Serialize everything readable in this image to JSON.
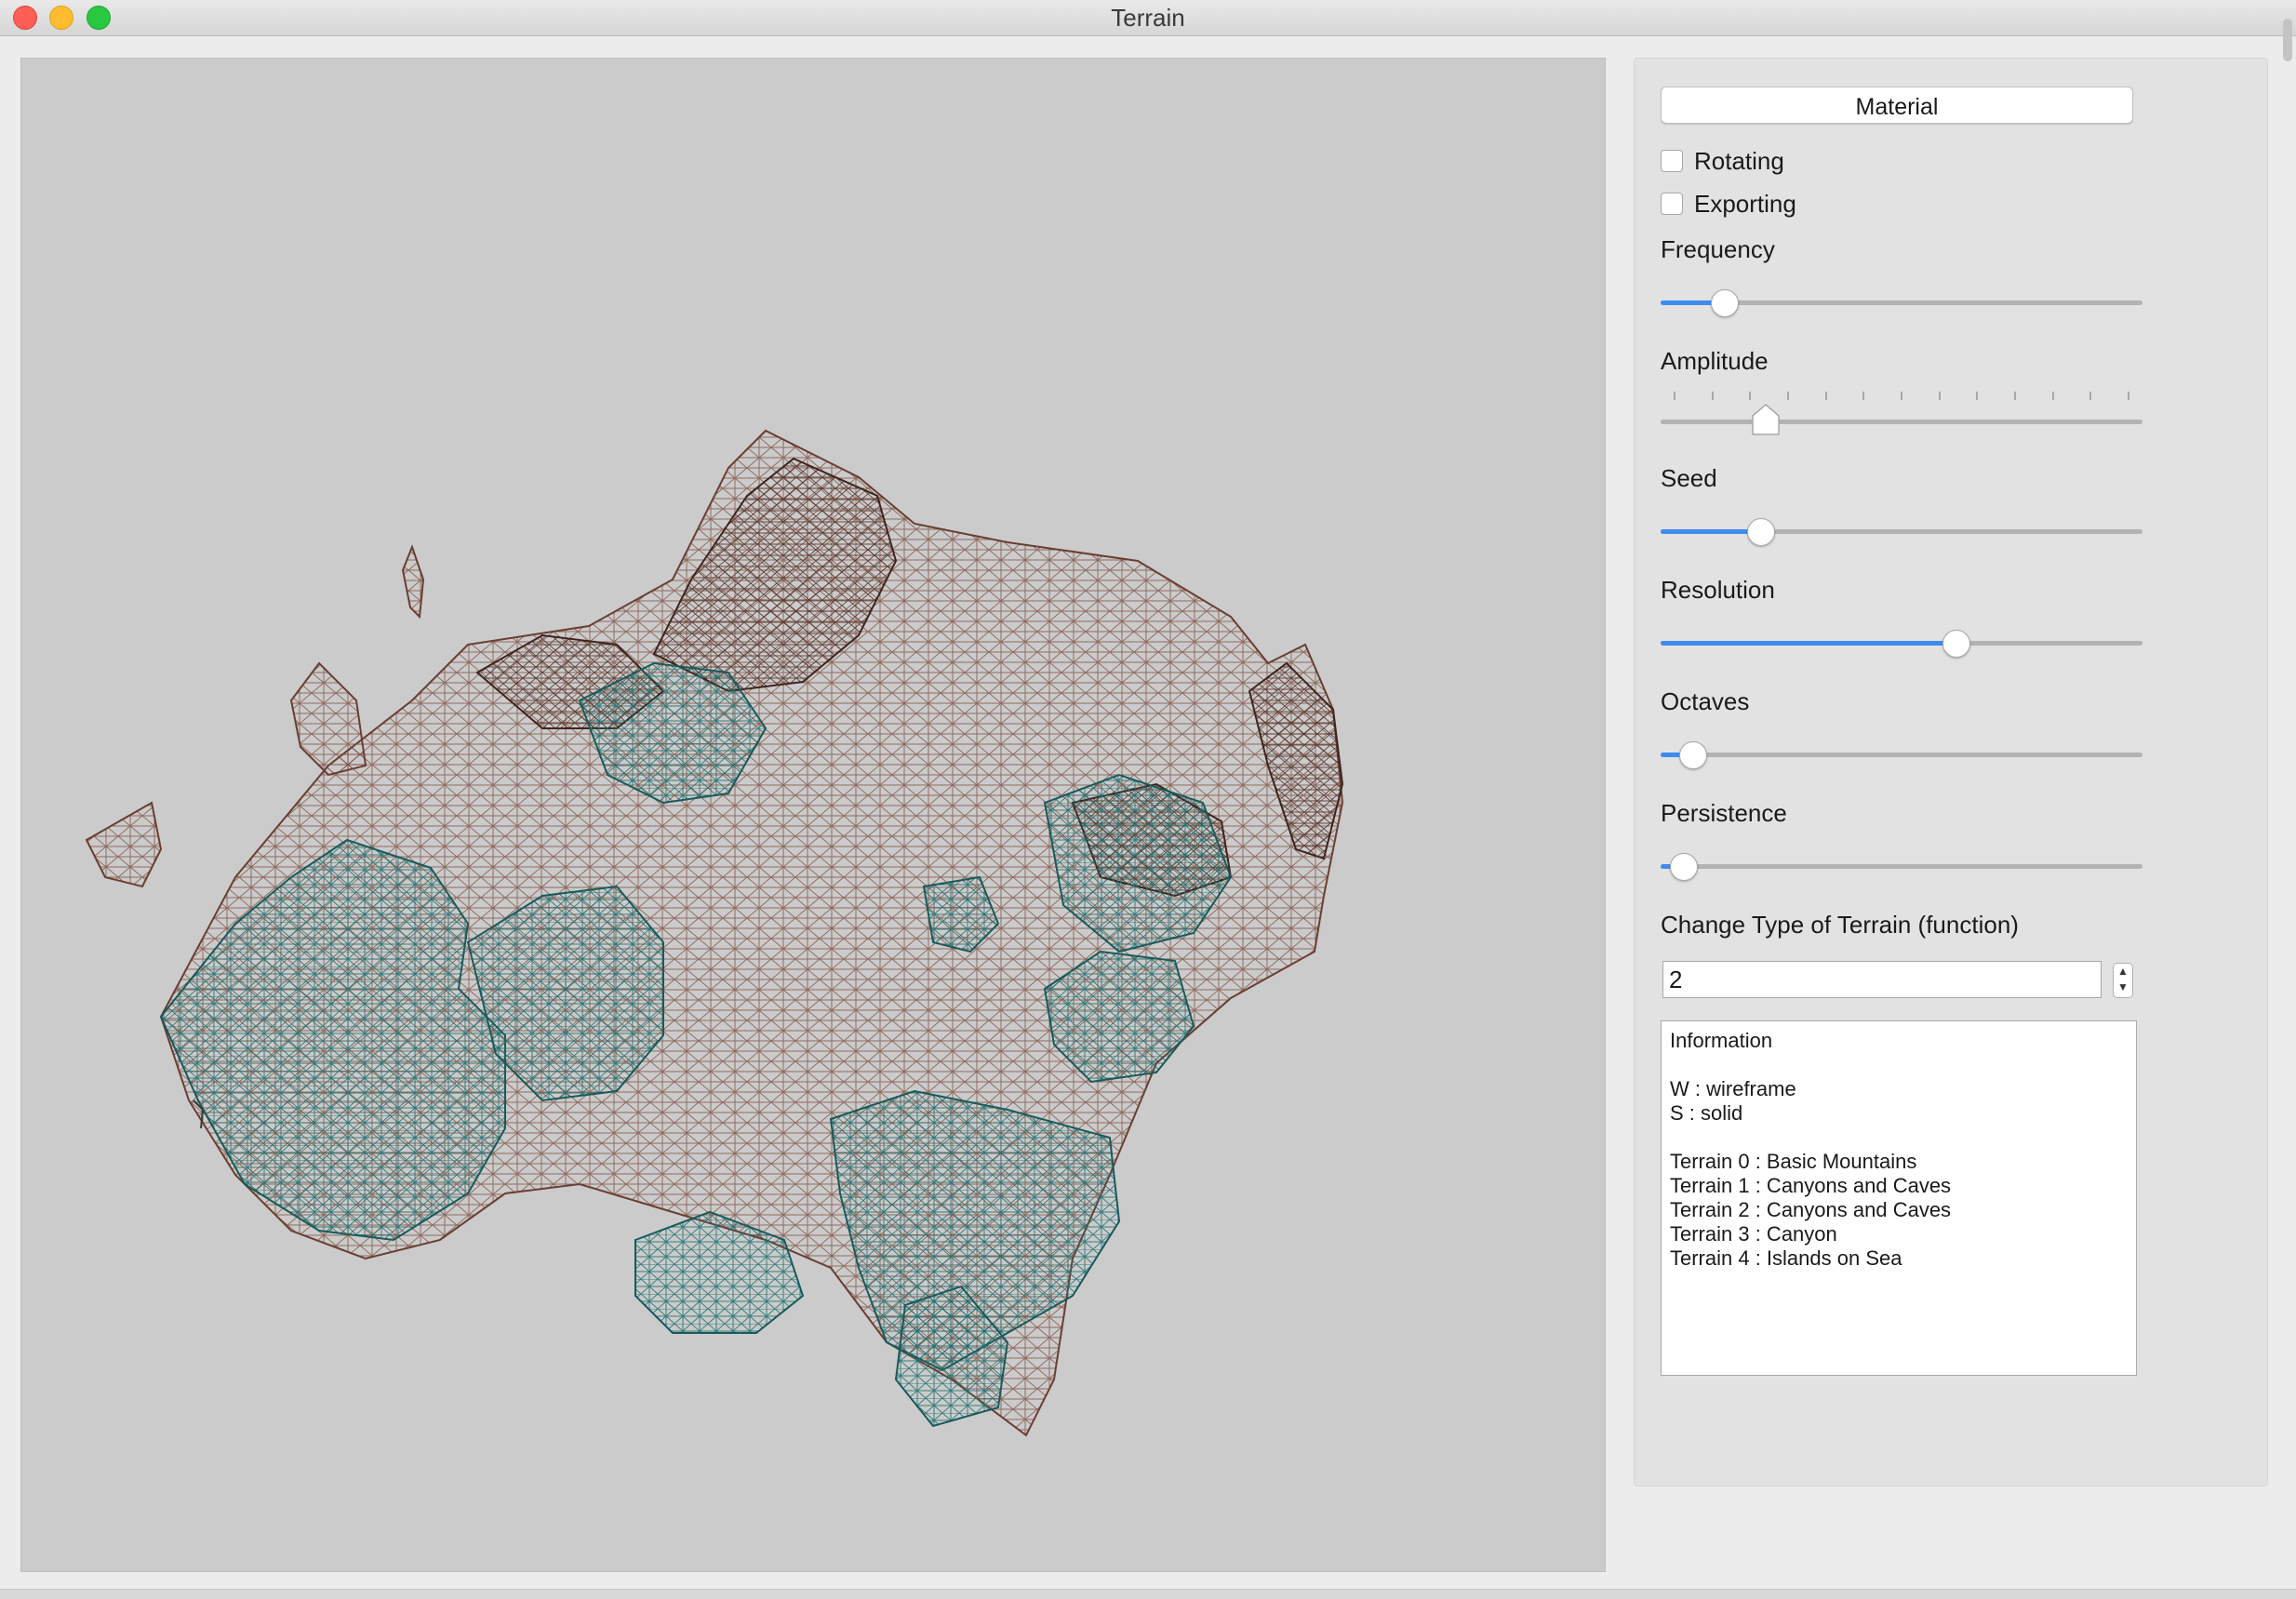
{
  "window": {
    "title": "Terrain"
  },
  "panel": {
    "material_label": "Material",
    "checkboxes": [
      {
        "label": "Rotating",
        "checked": false
      },
      {
        "label": "Exporting",
        "checked": false
      }
    ],
    "sliders": [
      {
        "label": "Frequency",
        "value": 0.11
      },
      {
        "label": "Amplitude",
        "value": 0.2,
        "ticks": 13
      },
      {
        "label": "Seed",
        "value": 0.19
      },
      {
        "label": "Resolution",
        "value": 0.62
      },
      {
        "label": "Octaves",
        "value": 0.04
      },
      {
        "label": "Persistence",
        "value": 0.02
      }
    ],
    "terrain_type_label": "Change Type of Terrain (function)",
    "terrain_type_value": "2",
    "info_lines": [
      "Information",
      "",
      "W : wireframe",
      "S : solid",
      "",
      "Terrain 0 : Basic Mountains",
      "Terrain 1 : Canyons and Caves",
      "Terrain 2 : Canyons and Caves",
      "Terrain 3 : Canyon",
      "Terrain 4 : Islands on Sea"
    ]
  },
  "colors": {
    "slider_fill": "#3d8cf0",
    "mesh_brown": "#7a4a3c",
    "mesh_teal": "#1f6e6e",
    "viewport_bg": "#cbcbcb"
  }
}
